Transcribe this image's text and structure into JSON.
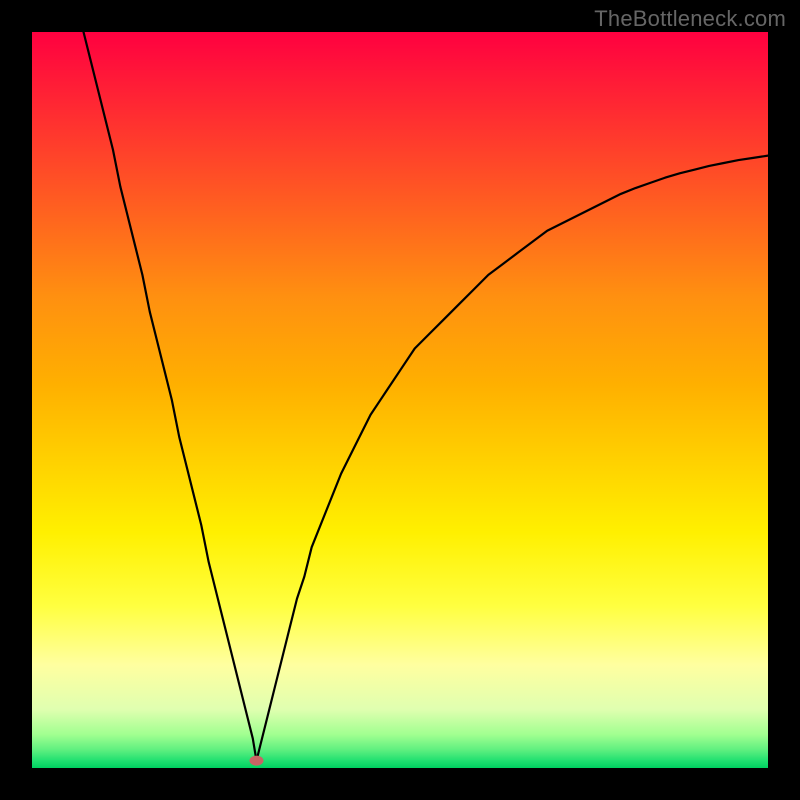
{
  "watermark": "TheBottleneck.com",
  "chart_data": {
    "type": "line",
    "title": "",
    "xlabel": "",
    "ylabel": "",
    "xlim": [
      0,
      100
    ],
    "ylim": [
      0,
      100
    ],
    "background_gradient_colors": [
      "#ff0040",
      "#ff3030",
      "#ff6020",
      "#ff9010",
      "#ffb000",
      "#ffd000",
      "#fff000",
      "#ffff40",
      "#ffffa0",
      "#e0ffb0",
      "#a0ff90",
      "#60f080",
      "#20e070",
      "#00d060"
    ],
    "marker": {
      "x": 30.5,
      "y": 1,
      "color": "#c86464"
    },
    "series": [
      {
        "name": "left-branch",
        "x": [
          7,
          8,
          9,
          10,
          11,
          12,
          13,
          14,
          15,
          16,
          17,
          18,
          19,
          20,
          21,
          22,
          23,
          24,
          25,
          26,
          27,
          28,
          29,
          30,
          30.5
        ],
        "values": [
          100,
          96,
          92,
          88,
          84,
          79,
          75,
          71,
          67,
          62,
          58,
          54,
          50,
          45,
          41,
          37,
          33,
          28,
          24,
          20,
          16,
          12,
          8,
          4,
          1
        ]
      },
      {
        "name": "right-branch",
        "x": [
          30.5,
          31,
          32,
          33,
          34,
          35,
          36,
          37,
          38,
          40,
          42,
          44,
          46,
          48,
          50,
          52,
          54,
          56,
          58,
          60,
          62,
          64,
          66,
          68,
          70,
          72,
          74,
          76,
          78,
          80,
          82,
          84,
          86,
          88,
          90,
          92,
          94,
          96,
          98,
          100
        ],
        "values": [
          1,
          3,
          7,
          11,
          15,
          19,
          23,
          26,
          30,
          35,
          40,
          44,
          48,
          51,
          54,
          57,
          59,
          61,
          63,
          65,
          67,
          68.5,
          70,
          71.5,
          73,
          74,
          75,
          76,
          77,
          78,
          78.8,
          79.5,
          80.2,
          80.8,
          81.3,
          81.8,
          82.2,
          82.6,
          82.9,
          83.2
        ]
      }
    ]
  }
}
